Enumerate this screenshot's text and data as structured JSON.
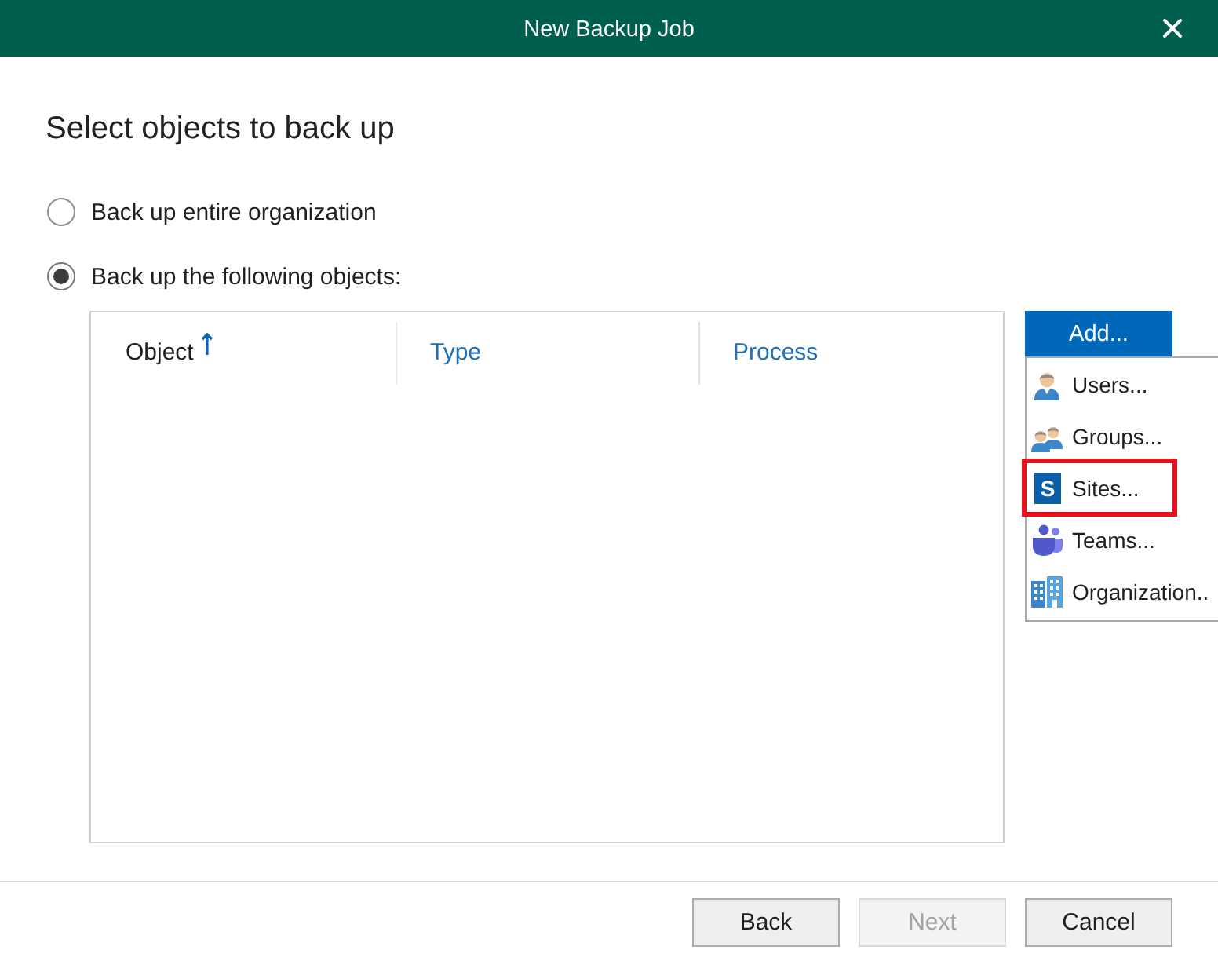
{
  "window": {
    "title": "New Backup Job"
  },
  "heading": "Select objects to back up",
  "scope_options": [
    {
      "label": "Back up entire organization",
      "selected": false
    },
    {
      "label": "Back up the following objects:",
      "selected": true
    }
  ],
  "table": {
    "columns": [
      {
        "label": "Object",
        "sorted": true
      },
      {
        "label": "Type",
        "sorted": false
      },
      {
        "label": "Process",
        "sorted": false
      }
    ]
  },
  "add_button": {
    "label": "Add..."
  },
  "add_menu": {
    "items": [
      {
        "kind": "users",
        "label": "Users...",
        "highlighted": false
      },
      {
        "kind": "groups",
        "label": "Groups...",
        "highlighted": false
      },
      {
        "kind": "sites",
        "label": "Sites...",
        "icon_letter": "S",
        "highlighted": true
      },
      {
        "kind": "teams",
        "label": "Teams...",
        "highlighted": false
      },
      {
        "kind": "organization",
        "label": "Organization..",
        "highlighted": false
      }
    ]
  },
  "buttons": [
    {
      "label": "Back",
      "disabled": false
    },
    {
      "label": "Next",
      "disabled": true
    },
    {
      "label": "Cancel",
      "disabled": false
    }
  ]
}
